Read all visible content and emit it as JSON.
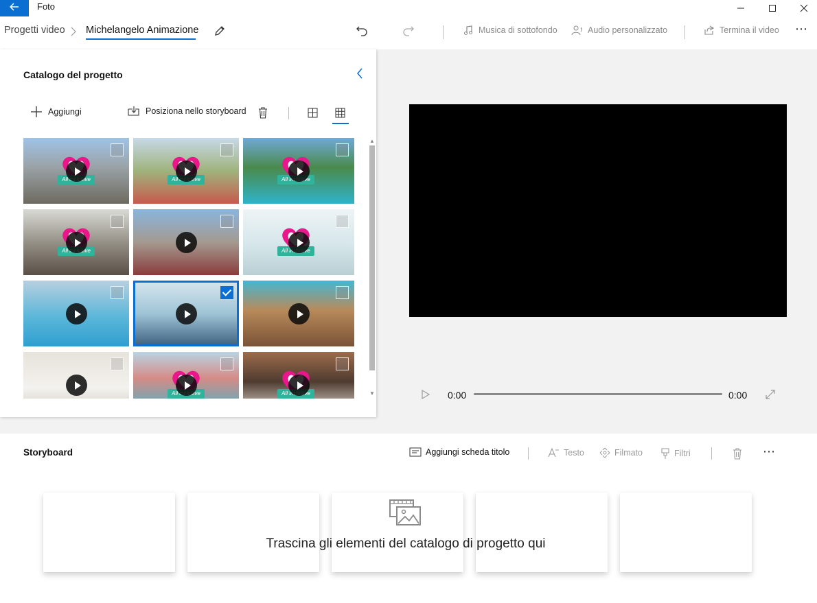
{
  "window": {
    "app_title": "Foto",
    "back_icon": "arrow-left-icon",
    "controls": [
      "minimize-icon",
      "maximize-icon",
      "close-icon"
    ]
  },
  "commandbar": {
    "breadcrumb_root": "Progetti video",
    "project_name": "Michelangelo Animazione",
    "background_music": "Musica di sottofondo",
    "custom_audio": "Audio personalizzato",
    "finish_video": "Termina il video",
    "more": "⋯"
  },
  "catalog": {
    "title": "Catalogo del progetto",
    "add_label": "Aggiungi",
    "place_label": "Posiziona nello storyboard",
    "logo_text": "All inclusive",
    "items": [
      {
        "bg": "linear-gradient(180deg,#9fc3e6 0%,#9aa2a6 45%,#6d6a60 100%)",
        "logo": true,
        "checked": false
      },
      {
        "bg": "linear-gradient(180deg,#c7d9e8 0%,#9fb37c 50%,#c75a4d 100%)",
        "logo": true,
        "checked": false
      },
      {
        "bg": "linear-gradient(180deg,#6fa9d8 0%,#4a8a4c 45%,#2fb3c9 100%)",
        "logo": true,
        "checked": false
      },
      {
        "bg": "linear-gradient(180deg,#d9dad5 0%,#8f8a80 55%,#5a4f46 100%)",
        "logo": true,
        "checked": false
      },
      {
        "bg": "linear-gradient(180deg,#89b5dd 0%,#a49a90 50%,#8a3b3b 100%)",
        "logo": false,
        "checked": false
      },
      {
        "bg": "linear-gradient(180deg,#eef4f6 0%,#d5e6ea 55%,#b9cfd4 100%)",
        "logo": true,
        "checked": false
      },
      {
        "bg": "linear-gradient(180deg,#b7cfe0 0%,#5bb7d9 55%,#2f9fd0 100%)",
        "logo": false,
        "checked": false
      },
      {
        "bg": "linear-gradient(180deg,#d8e6ee 0%,#9fc4d6 50%,#3c5f7d 100%)",
        "logo": false,
        "checked": true
      },
      {
        "bg": "linear-gradient(180deg,#46b6d2 0%,#b88a5a 45%,#7a5236 100%)",
        "logo": false,
        "checked": false
      },
      {
        "bg": "linear-gradient(180deg,#e6e3dc 0%,#f4f2ee 55%,#c9c4ba 100%)",
        "logo": false,
        "checked": false
      },
      {
        "bg": "linear-gradient(180deg,#b9d4e4 0%,#d58b86 40%,#31b9d1 100%)",
        "logo": true,
        "checked": false
      },
      {
        "bg": "linear-gradient(180deg,#9d6c4c 0%,#4f3b30 45%,#f3eee6 100%)",
        "logo": true,
        "checked": false
      }
    ]
  },
  "preview": {
    "time_current": "0:00",
    "time_total": "0:00"
  },
  "storyboard": {
    "title": "Storyboard",
    "add_title_card": "Aggiungi scheda titolo",
    "text": "Testo",
    "motion": "Filmato",
    "filters": "Filtri",
    "more": "⋯",
    "drop_hint": "Trascina gli elementi del catalogo di progetto qui"
  }
}
